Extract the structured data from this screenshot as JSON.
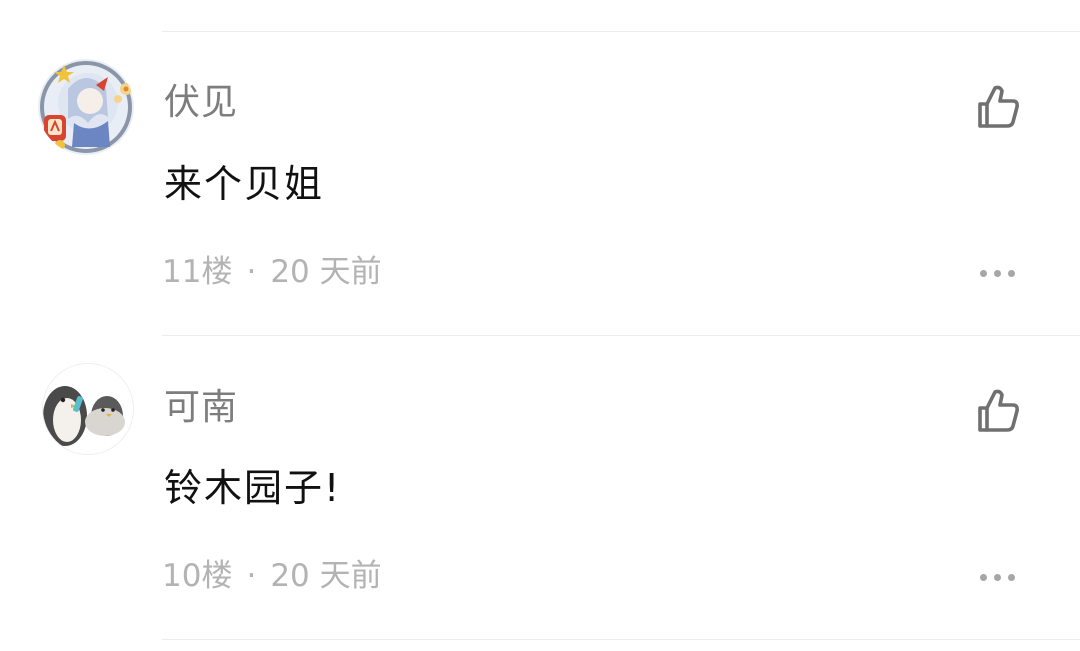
{
  "comments": [
    {
      "username": "伏见",
      "content": "来个贝姐",
      "floor": "11楼",
      "separator": "·",
      "time": "20 天前",
      "like_icon": "thumbs-up-icon",
      "more_icon": "more-dots-icon",
      "avatar": "anime-character-avatar"
    },
    {
      "username": "可南",
      "content": "铃木园子!",
      "floor": "10楼",
      "separator": "·",
      "time": "20 天前",
      "like_icon": "thumbs-up-icon",
      "more_icon": "more-dots-icon",
      "avatar": "penguin-avatar"
    }
  ],
  "colors": {
    "username": "#7d7d7d",
    "content": "#111111",
    "meta": "#b3b3b3",
    "icon": "#707070",
    "divider": "#ececec"
  }
}
